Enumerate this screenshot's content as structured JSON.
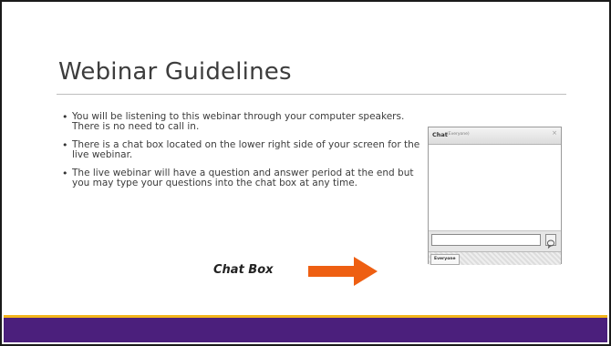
{
  "slide": {
    "title": "Webinar Guidelines",
    "bullets": [
      "You will be listening to this webinar through your computer speakers. There is no need to call in.",
      "There is a chat box located on the lower right side of your screen for the live  webinar.",
      "The live webinar will have a question and answer period at the end but you may type your questions into the chat box at any time."
    ],
    "bullet_marker": "•",
    "chatbox_label": "Chat Box",
    "arrow_color": "#ee5f12"
  },
  "chat_panel": {
    "title": "Chat",
    "subtitle": "(Everyone)",
    "close": "×",
    "tab_label": "Everyone",
    "input_value": ""
  },
  "colors": {
    "footer_bar": "#4b1f7c",
    "footer_accent": "#f3b51c",
    "title": "#3d3d3d"
  }
}
